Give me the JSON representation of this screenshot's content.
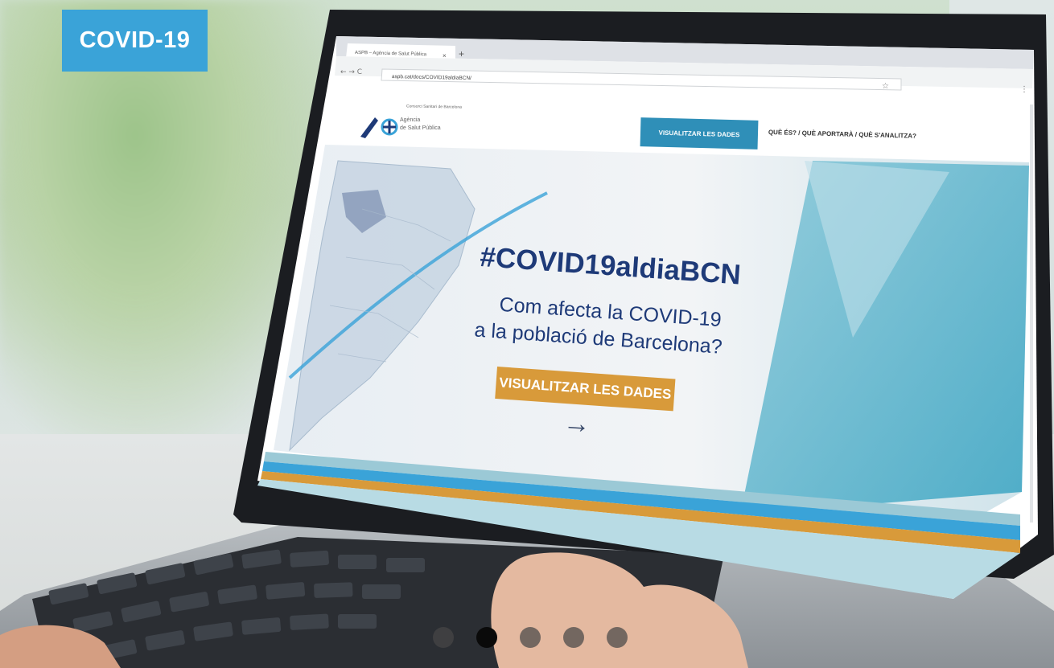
{
  "badge": {
    "label": "COVID-19"
  },
  "browser": {
    "tab_title": "ASPB – Agència de Salut Pública",
    "url": "aspb.cat/docs/COVID19aldiaBCN/",
    "new_tab_symbol": "+",
    "close_symbol": "×"
  },
  "site": {
    "org_name": "Consorci Sanitari de Barcelona",
    "logo_line1": "Agència",
    "logo_line2": "de Salut Pública",
    "nav_button": "VISUALITZAR LES DADES",
    "nav_link": "QUÈ ÉS? / QUÈ APORTARÀ / QUÈ S'ANALITZA?"
  },
  "hero": {
    "title": "#COVID19aldiaBCN",
    "subtitle_line1": "Com afecta la COVID-19",
    "subtitle_line2": "a la població de Barcelona?",
    "cta": "VISUALITZAR LES DADES",
    "arrow": "→"
  },
  "carousel": {
    "active_index": 1,
    "count": 5
  },
  "colors": {
    "badge": "#3aa3d8",
    "title": "#1e3a78",
    "cta": "#d89a3a",
    "nav_button": "#2f8fb8"
  }
}
